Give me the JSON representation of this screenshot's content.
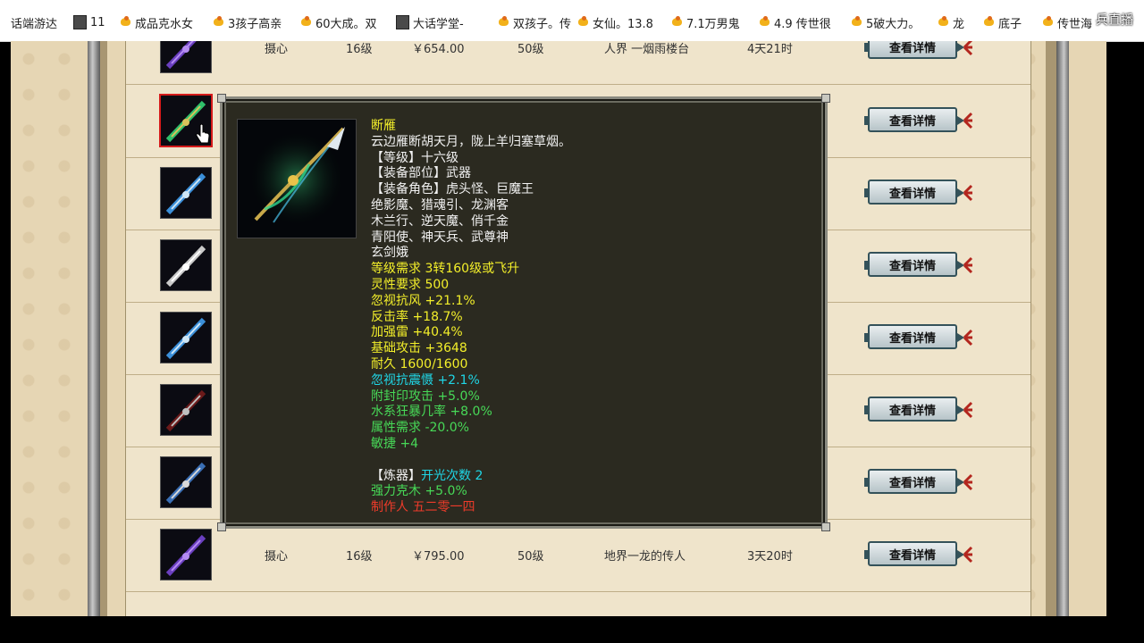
{
  "bookmarks": [
    {
      "icon": "none",
      "label": "话端游达"
    },
    {
      "icon": "page-icon",
      "label": "11"
    },
    {
      "icon": "star-icon",
      "label": "成品克水女"
    },
    {
      "icon": "star-icon",
      "label": "3孩子高亲"
    },
    {
      "icon": "star-icon",
      "label": "60大成。双"
    },
    {
      "icon": "page-icon",
      "label": "大话学堂-"
    },
    {
      "icon": "star-icon",
      "label": "双孩子。传"
    },
    {
      "icon": "star-icon",
      "label": "女仙。13.8"
    },
    {
      "icon": "star-icon",
      "label": "7.1万男鬼"
    },
    {
      "icon": "star-icon",
      "label": "4.9 传世很"
    },
    {
      "icon": "star-icon",
      "label": "5破大力。"
    },
    {
      "icon": "star-icon",
      "label": "龙"
    },
    {
      "icon": "star-icon",
      "label": "底子"
    },
    {
      "icon": "star-icon",
      "label": "传世海"
    }
  ],
  "live_overlay": "兵直播",
  "rows": [
    {
      "name": "摄心",
      "level": "16级",
      "price": "￥654.00",
      "req": "50级",
      "seller": "人界 一烟雨楼台",
      "time": "4天21时",
      "button": "查看详情",
      "thumb": "purple"
    },
    {
      "name": "",
      "level": "",
      "price": "",
      "req": "",
      "seller": "",
      "time": "",
      "button": "查看详情",
      "thumb": "green",
      "selected": true
    },
    {
      "name": "",
      "level": "",
      "price": "",
      "req": "",
      "seller": "",
      "time": "",
      "button": "查看详情",
      "thumb": "blue"
    },
    {
      "name": "",
      "level": "",
      "price": "",
      "req": "",
      "seller": "",
      "time": "",
      "button": "查看详情",
      "thumb": "silver"
    },
    {
      "name": "",
      "level": "",
      "price": "",
      "req": "",
      "seller": "",
      "time": "",
      "button": "查看详情",
      "thumb": "blue"
    },
    {
      "name": "",
      "level": "",
      "price": "",
      "req": "",
      "seller": "",
      "time": "",
      "button": "查看详情",
      "thumb": "dark"
    },
    {
      "name": "",
      "level": "",
      "price": "",
      "req": "",
      "seller": "",
      "time": "",
      "button": "查看详情",
      "thumb": "hammer"
    },
    {
      "name": "摄心",
      "level": "16级",
      "price": "￥795.00",
      "req": "50级",
      "seller": "地界一龙的传人",
      "time": "3天20时",
      "button": "查看详情",
      "thumb": "purple"
    }
  ],
  "tooltip": {
    "lines": [
      {
        "text": "断雁",
        "color": "yellow"
      },
      {
        "text": "云边雁断胡天月，陇上羊归塞草烟。",
        "color": "white"
      },
      {
        "text": "【等级】十六级",
        "color": "white"
      },
      {
        "text": "【装备部位】武器",
        "color": "white"
      },
      {
        "text": "【装备角色】虎头怪、巨魔王",
        "color": "white"
      },
      {
        "text": "绝影魔、猎魂引、龙渊客",
        "color": "white"
      },
      {
        "text": "木兰行、逆天魔、俏千金",
        "color": "white"
      },
      {
        "text": "青阳使、神天兵、武尊神",
        "color": "white"
      },
      {
        "text": "玄剑娥",
        "color": "white"
      },
      {
        "text": "等级需求 3转160级或飞升",
        "color": "yellow"
      },
      {
        "text": "灵性要求 500",
        "color": "yellow"
      },
      {
        "text": "忽视抗风 +21.1%",
        "color": "yellow"
      },
      {
        "text": "反击率 +18.7%",
        "color": "yellow"
      },
      {
        "text": "加强雷 +40.4%",
        "color": "yellow"
      },
      {
        "text": "基础攻击 +3648",
        "color": "yellow"
      },
      {
        "text": "耐久 1600/1600",
        "color": "yellow"
      },
      {
        "text": "忽视抗震慑 +2.1%",
        "color": "cyan"
      },
      {
        "text": "附封印攻击 +5.0%",
        "color": "green"
      },
      {
        "text": "水系狂暴几率 +8.0%",
        "color": "green"
      },
      {
        "text": "属性需求 -20.0%",
        "color": "green"
      },
      {
        "text": "敏捷 +4",
        "color": "green"
      },
      {
        "text": "",
        "color": "white"
      },
      {
        "text": "【炼器】",
        "color": "white",
        "suffix": "开光次数 2",
        "suffix_color": "cyan"
      },
      {
        "text": "强力克木 +5.0%",
        "color": "green"
      },
      {
        "text": "制作人 五二零一四",
        "color": "red"
      }
    ]
  },
  "colors": {
    "yellow": "#f3ef2a",
    "white": "#f2f2f2",
    "cyan": "#1fd6e6",
    "green": "#47d957",
    "red": "#ee3b2a"
  }
}
